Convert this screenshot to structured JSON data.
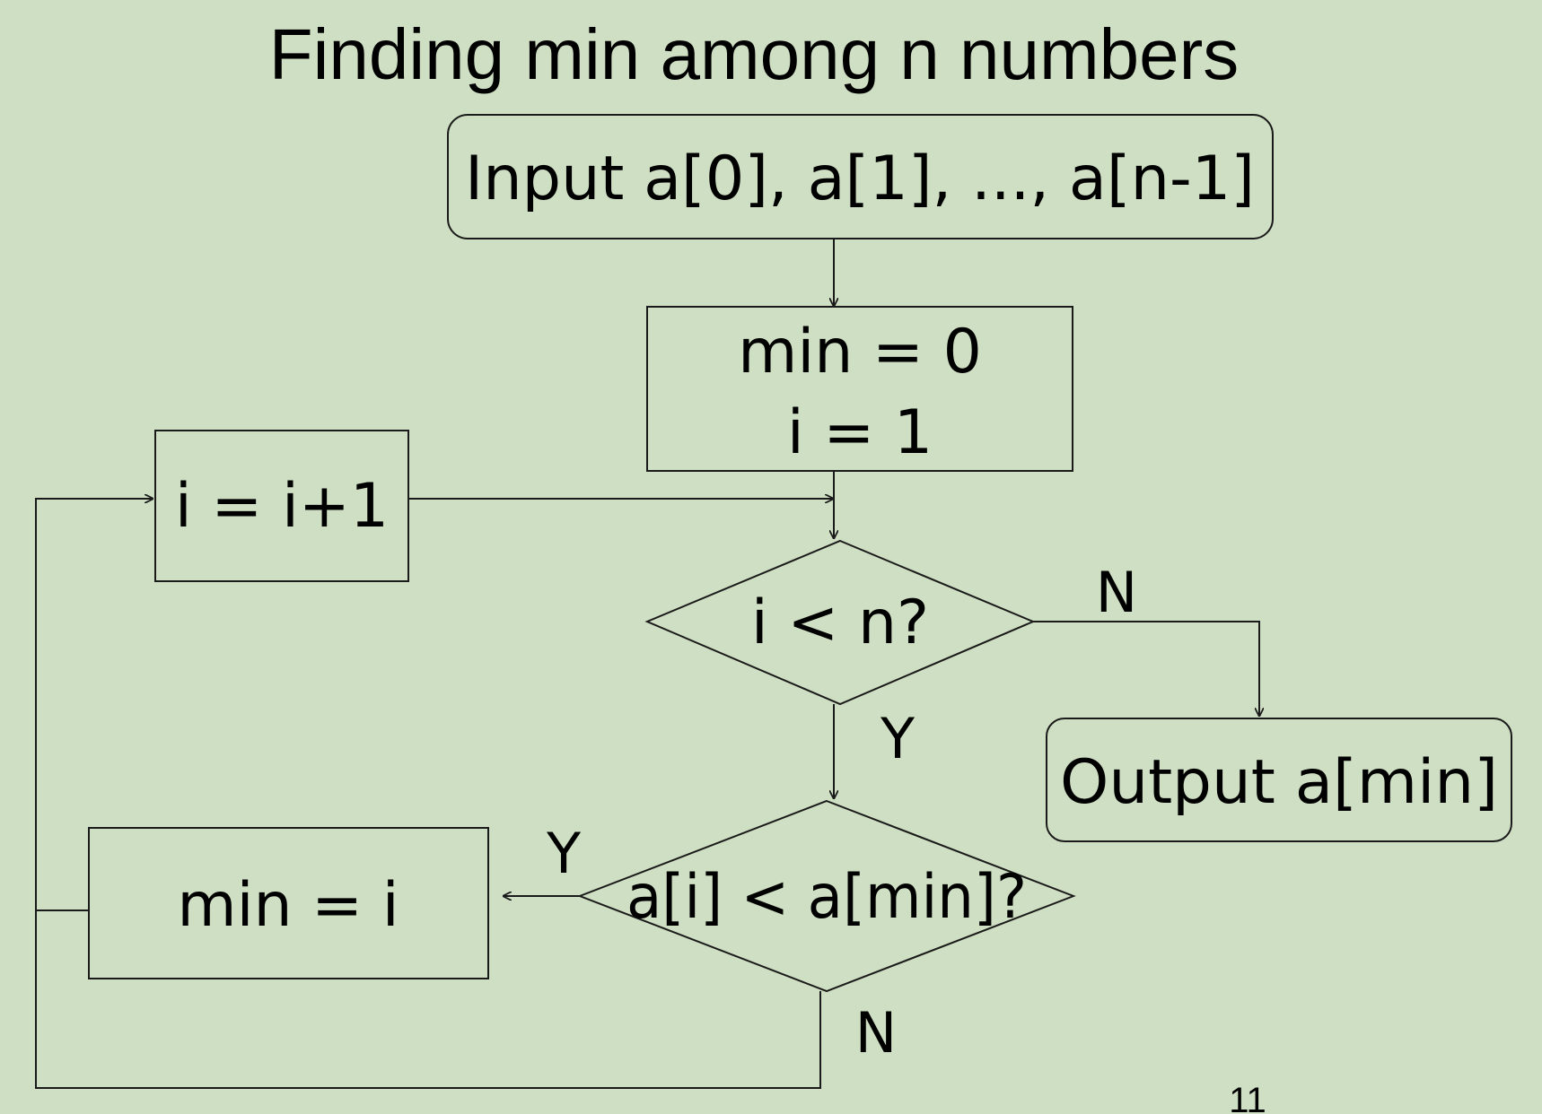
{
  "title": "Finding min among n numbers",
  "nodes": {
    "input": "Input a[0], a[1], ..., a[n-1]",
    "init_min": "min = 0",
    "init_i": "i = 1",
    "increment": "i = i+1",
    "condition_loop": "i < n?",
    "output": "Output a[min]",
    "condition_compare": "a[i] < a[min]?",
    "assign_min": "min = i"
  },
  "edge_labels": {
    "loop_no": "N",
    "loop_yes": "Y",
    "compare_yes": "Y",
    "compare_no": "N"
  },
  "page_number": "11"
}
